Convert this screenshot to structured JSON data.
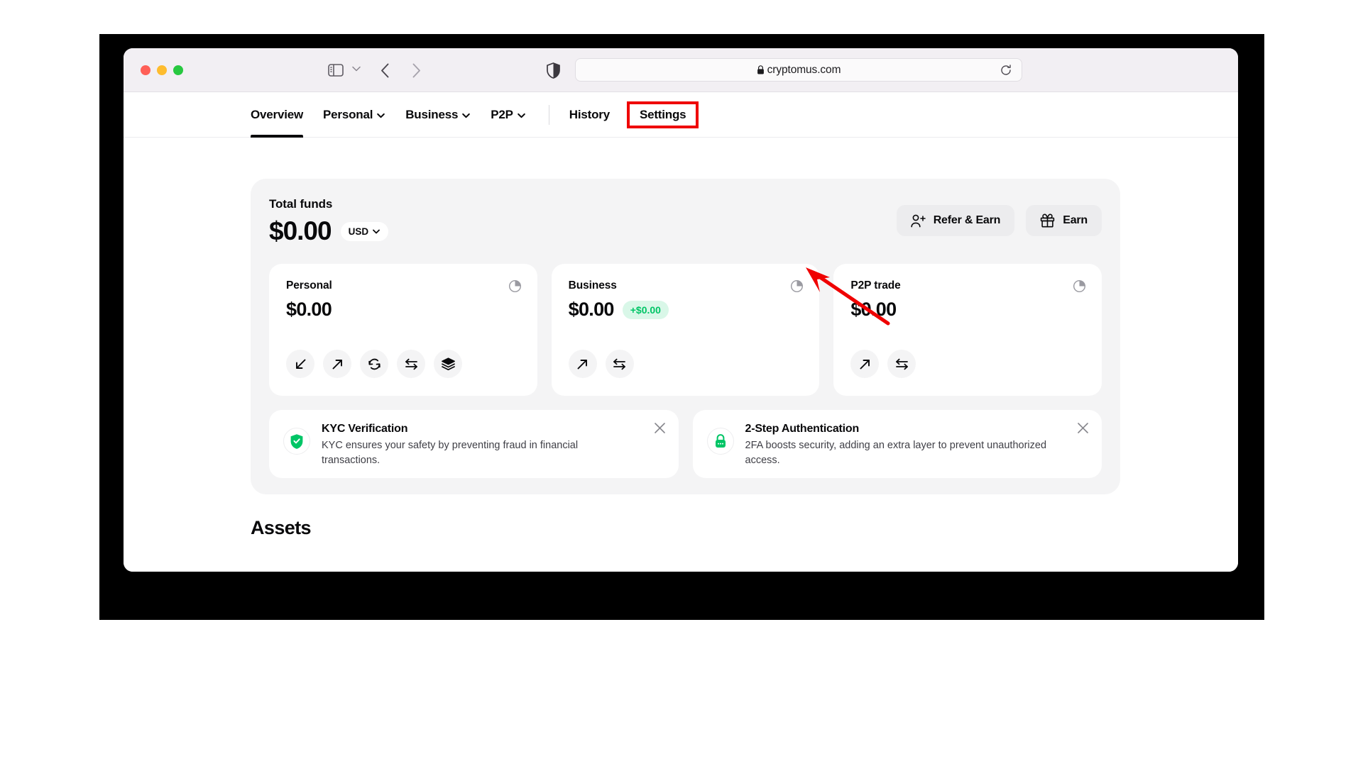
{
  "browser": {
    "traffic_lights": [
      "close",
      "minimize",
      "maximize"
    ],
    "url": "cryptomus.com",
    "icons": {
      "sidebar_toggle": "sidebar-toggle-icon",
      "sidebar_chevron": "chevron-down-icon",
      "back": "chevron-left-icon",
      "forward": "chevron-right-icon",
      "shield": "shield-icon",
      "lock": "lock-icon",
      "reload": "reload-icon",
      "share": "share-icon",
      "new_tab": "plus-icon",
      "tab_overview": "tab-grid-icon"
    }
  },
  "site_nav": {
    "items": [
      {
        "label": "Overview",
        "active": true,
        "has_caret": false
      },
      {
        "label": "Personal",
        "active": false,
        "has_caret": true
      },
      {
        "label": "Business",
        "active": false,
        "has_caret": true
      },
      {
        "label": "P2P",
        "active": false,
        "has_caret": true
      }
    ],
    "right_items": [
      {
        "label": "History",
        "highlighted": false
      },
      {
        "label": "Settings",
        "highlighted": true
      }
    ],
    "highlight_color": "#ef0000"
  },
  "dashboard": {
    "total_funds_label": "Total funds",
    "total_amount": "$0.00",
    "currency": "USD",
    "actions": [
      {
        "label": "Refer & Earn",
        "icon": "user-plus-icon"
      },
      {
        "label": "Earn",
        "icon": "gift-icon"
      }
    ],
    "balance_cards": [
      {
        "title": "Personal",
        "amount": "$0.00",
        "badge": null,
        "actions": [
          "deposit-icon",
          "withdraw-icon",
          "exchange-icon",
          "transfer-icon",
          "stack-icon"
        ]
      },
      {
        "title": "Business",
        "amount": "$0.00",
        "badge": "+$0.00",
        "badge_color": "#00c566",
        "actions": [
          "withdraw-icon",
          "transfer-icon"
        ]
      },
      {
        "title": "P2P trade",
        "amount": "$0.00",
        "badge": null,
        "actions": [
          "withdraw-icon",
          "transfer-icon"
        ]
      }
    ],
    "banners": [
      {
        "title": "KYC Verification",
        "description": "KYC ensures your safety by preventing fraud in financial transactions.",
        "icon": "shield-check-icon",
        "icon_color": "#00c566"
      },
      {
        "title": "2-Step Authentication",
        "description": "2FA boosts security, adding an extra layer to prevent unauthorized access.",
        "icon": "lock-icon",
        "icon_color": "#00c566"
      }
    ]
  },
  "assets": {
    "title": "Assets"
  }
}
